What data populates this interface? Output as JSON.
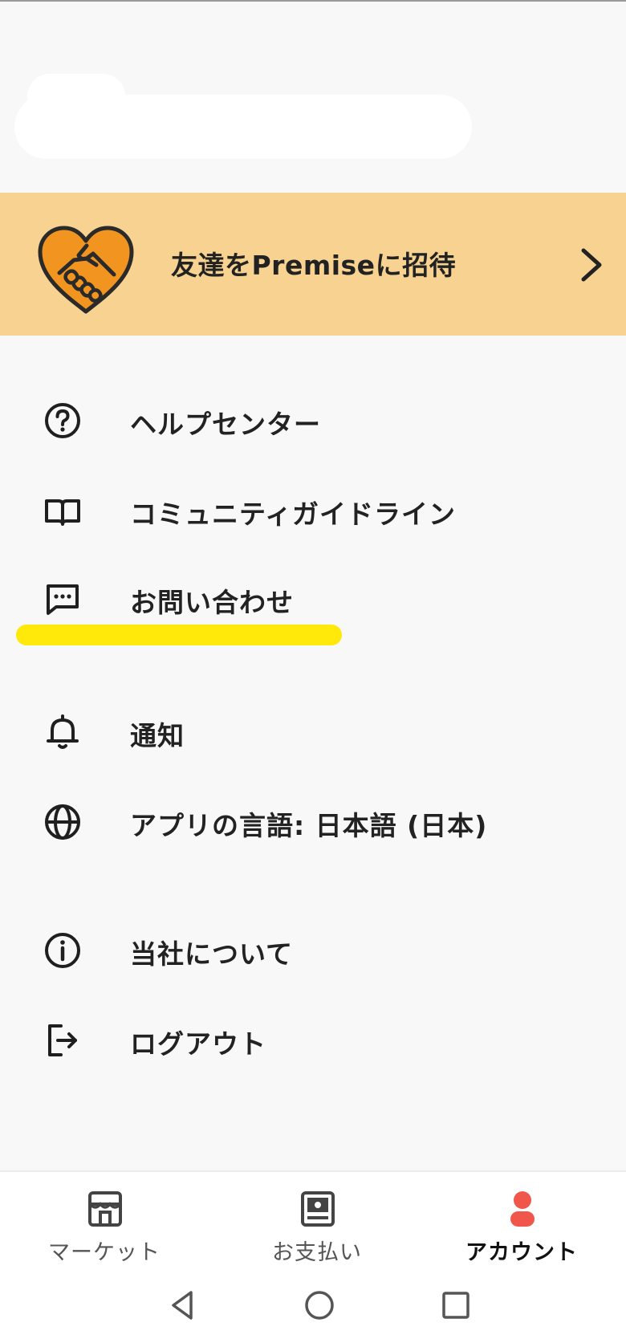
{
  "invite": {
    "label": "友達をPremiseに招待",
    "icon": "heart-handshake-icon",
    "background": "#f8d290",
    "heart_color": "#f29520"
  },
  "menu": {
    "items": [
      {
        "label": "ヘルプセンター",
        "icon": "question-circle-icon"
      },
      {
        "label": "コミュニティガイドライン",
        "icon": "book-icon"
      },
      {
        "label": "お問い合わせ",
        "icon": "chat-bubble-icon"
      },
      {
        "label": "通知",
        "icon": "bell-icon"
      },
      {
        "label": "アプリの言語: 日本語 (日本)",
        "icon": "globe-icon"
      },
      {
        "label": "当社について",
        "icon": "info-circle-icon"
      },
      {
        "label": "ログアウト",
        "icon": "logout-icon"
      }
    ],
    "highlight_color": "#ffe90a"
  },
  "bottom_nav": {
    "tabs": [
      {
        "label": "マーケット",
        "icon": "store-icon",
        "active": false
      },
      {
        "label": "お支払い",
        "icon": "wallet-icon",
        "active": false
      },
      {
        "label": "アカウント",
        "icon": "person-icon",
        "active": true
      }
    ],
    "active_color": "#f0564a"
  },
  "system_nav": {
    "buttons": [
      "back-icon",
      "home-icon",
      "recents-icon"
    ]
  }
}
